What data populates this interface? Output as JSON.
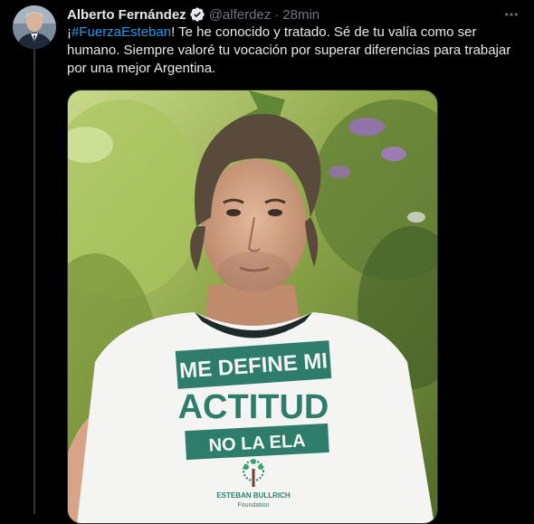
{
  "tweet": {
    "author": {
      "display_name": "Alberto Fernández",
      "handle": "@alferdez",
      "verified_icon": "verified-badge-icon"
    },
    "separator": "·",
    "time_ago": "28min",
    "more_icon": "more-horizontal-icon",
    "text": {
      "prefix": "¡",
      "hashtag": "#FuerzaEsteban",
      "body": "! Te he conocido y tratado. Sé de tu valía como ser humano. Siempre valoré tu vocación por superar diferencias para trabajar por una mejor Argentina."
    },
    "image": {
      "shirt_line1": "ME DEFINE MI",
      "shirt_line2": "ACTITUD",
      "shirt_line3": "NO LA ELA",
      "logo_line1": "ESTEBAN BULLRICH",
      "logo_line2": "Foundation"
    }
  },
  "colors": {
    "background": "#000000",
    "text": "#e7e9ea",
    "secondary": "#71767b",
    "link": "#1d9bf0",
    "shirt_green": "#2e7d6b"
  }
}
